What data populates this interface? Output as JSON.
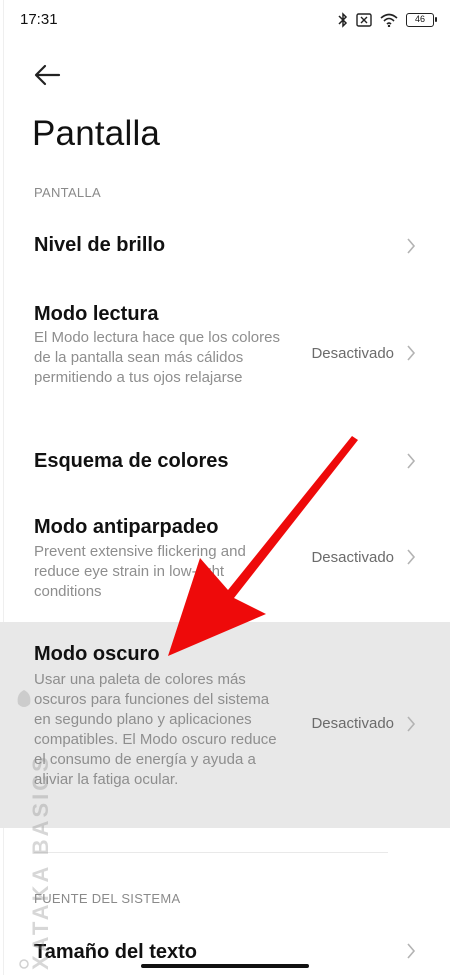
{
  "status": {
    "time": "17:31",
    "battery": "46"
  },
  "header": {
    "title": "Pantalla"
  },
  "sections": [
    {
      "header": "PANTALLA"
    },
    {
      "header": "FUENTE DEL SISTEMA"
    }
  ],
  "rows": {
    "brillo": {
      "title": "Nivel de brillo"
    },
    "lectura": {
      "title": "Modo lectura",
      "desc": "El Modo lectura hace que los colores de la pantalla sean más cálidos permitiendo a tus ojos relajarse",
      "value": "Desactivado"
    },
    "esquema": {
      "title": "Esquema de colores"
    },
    "antiparpadeo": {
      "title": "Modo antiparpadeo",
      "desc": "Prevent extensive flickering and reduce eye strain in low-light conditions",
      "value": "Desactivado"
    },
    "oscuro": {
      "title": "Modo oscuro",
      "desc": "Usar una paleta de colores más oscuros para funciones del sistema en segundo plano y aplicaciones compatibles. El Modo oscuro reduce el consumo de energía y ayuda a aliviar la fatiga ocular.",
      "value": "Desactivado"
    },
    "tamano": {
      "title": "Tamaño del texto"
    }
  },
  "watermark": "XATAKA BASICS",
  "colors": {
    "accent_arrow": "#ee0a0a",
    "highlight": "#e8e8e8"
  }
}
